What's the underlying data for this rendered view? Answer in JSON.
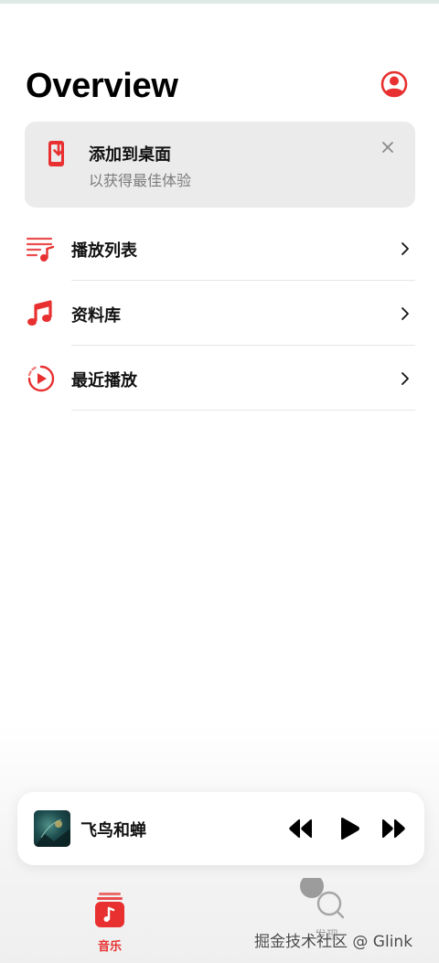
{
  "header": {
    "title": "Overview"
  },
  "banner": {
    "title": "添加到桌面",
    "subtitle": "以获得最佳体验"
  },
  "menu": {
    "items": [
      {
        "label": "播放列表",
        "icon": "playlist-icon"
      },
      {
        "label": "资料库",
        "icon": "music-note-icon"
      },
      {
        "label": "最近播放",
        "icon": "recent-play-icon"
      }
    ]
  },
  "player": {
    "song_title": "飞鸟和蝉"
  },
  "tabs": [
    {
      "label": "音乐",
      "icon": "music-tab-icon",
      "active": true
    },
    {
      "label": "发现",
      "icon": "search-icon",
      "active": false
    }
  ],
  "watermark": "掘金技术社区 @ Glink",
  "colors": {
    "accent": "#e83030",
    "banner_bg": "#ebebeb",
    "subtle_text": "#7b7b7b"
  }
}
